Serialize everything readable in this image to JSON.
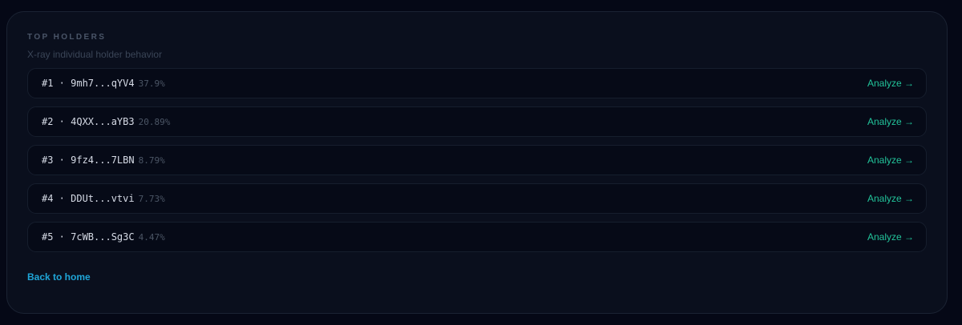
{
  "panel": {
    "title": "TOP HOLDERS",
    "subtitle": "X-ray individual holder behavior"
  },
  "holders": [
    {
      "label": "#1 · 9mh7...qYV4",
      "percent": "37.9%",
      "action": "Analyze →"
    },
    {
      "label": "#2 · 4QXX...aYB3",
      "percent": "20.89%",
      "action": "Analyze →"
    },
    {
      "label": "#3 · 9fz4...7LBN",
      "percent": "8.79%",
      "action": "Analyze →"
    },
    {
      "label": "#4 · DDUt...vtvi",
      "percent": "7.73%",
      "action": "Analyze →"
    },
    {
      "label": "#5 · 7cWB...Sg3C",
      "percent": "4.47%",
      "action": "Analyze →"
    }
  ],
  "footer": {
    "back_label": "Back to home"
  },
  "colors": {
    "background": "#050816",
    "panel": "#0a0f1d",
    "row": "#060a17",
    "accent_green": "#22c39a",
    "accent_blue": "#1fa6d8"
  }
}
